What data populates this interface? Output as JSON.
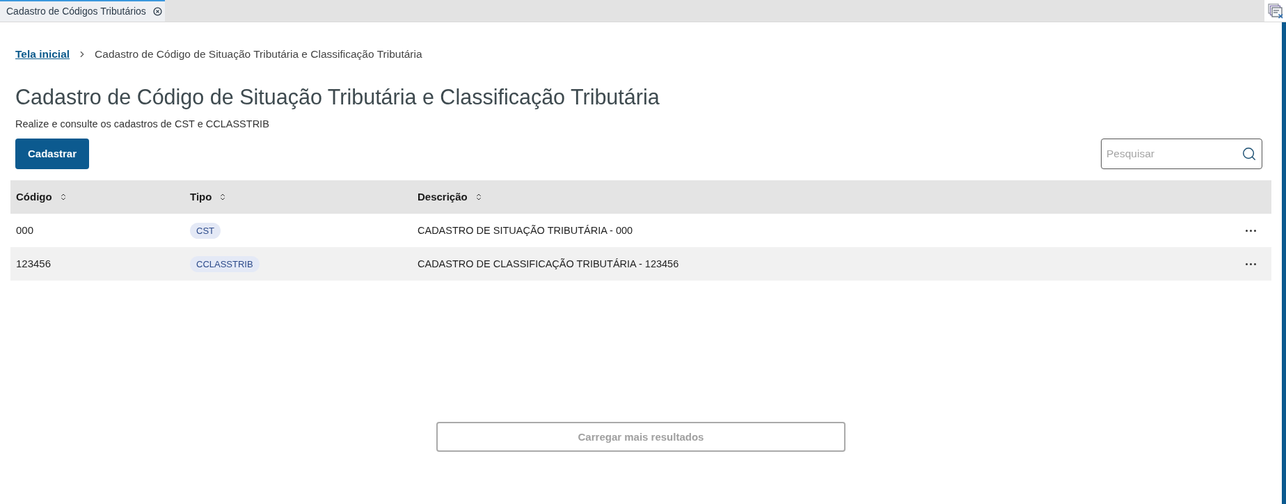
{
  "tabs": [
    {
      "label": "Cadastro de Códigos Tributários",
      "selected": true,
      "closable": true
    }
  ],
  "breadcrumb": [
    {
      "label": "Tela inicial",
      "kind": "link"
    },
    {
      "label": "Cadastro de Código de Situação Tributária e Classificação Tributária",
      "kind": "current"
    }
  ],
  "header": {
    "title": "Cadastro de Código de Situação Tributária e Classificação Tributária",
    "subtitle": "Realize e consulte os cadastros de CST e CCLASSTRIB"
  },
  "primary_button": {
    "label": "Cadastrar"
  },
  "search": {
    "placeholder": "Pesquisar"
  },
  "table": {
    "columns": [
      {
        "label": "Código",
        "sortable": true
      },
      {
        "label": "Tipo",
        "sortable": true
      },
      {
        "label": "Descrição",
        "sortable": true
      }
    ],
    "rows": [
      {
        "code": "000",
        "type": "CST",
        "description": "CADASTRO DE SITUAÇÃO TRIBUTÁRIA - 000"
      },
      {
        "code": "123456",
        "type": "CCLASSTRIB",
        "description": "CADASTRO DE CLASSIFICAÇÃO TRIBUTÁRIA - 123456"
      }
    ]
  },
  "load_more": {
    "label": "Carregar mais resultados",
    "disabled": true
  }
}
